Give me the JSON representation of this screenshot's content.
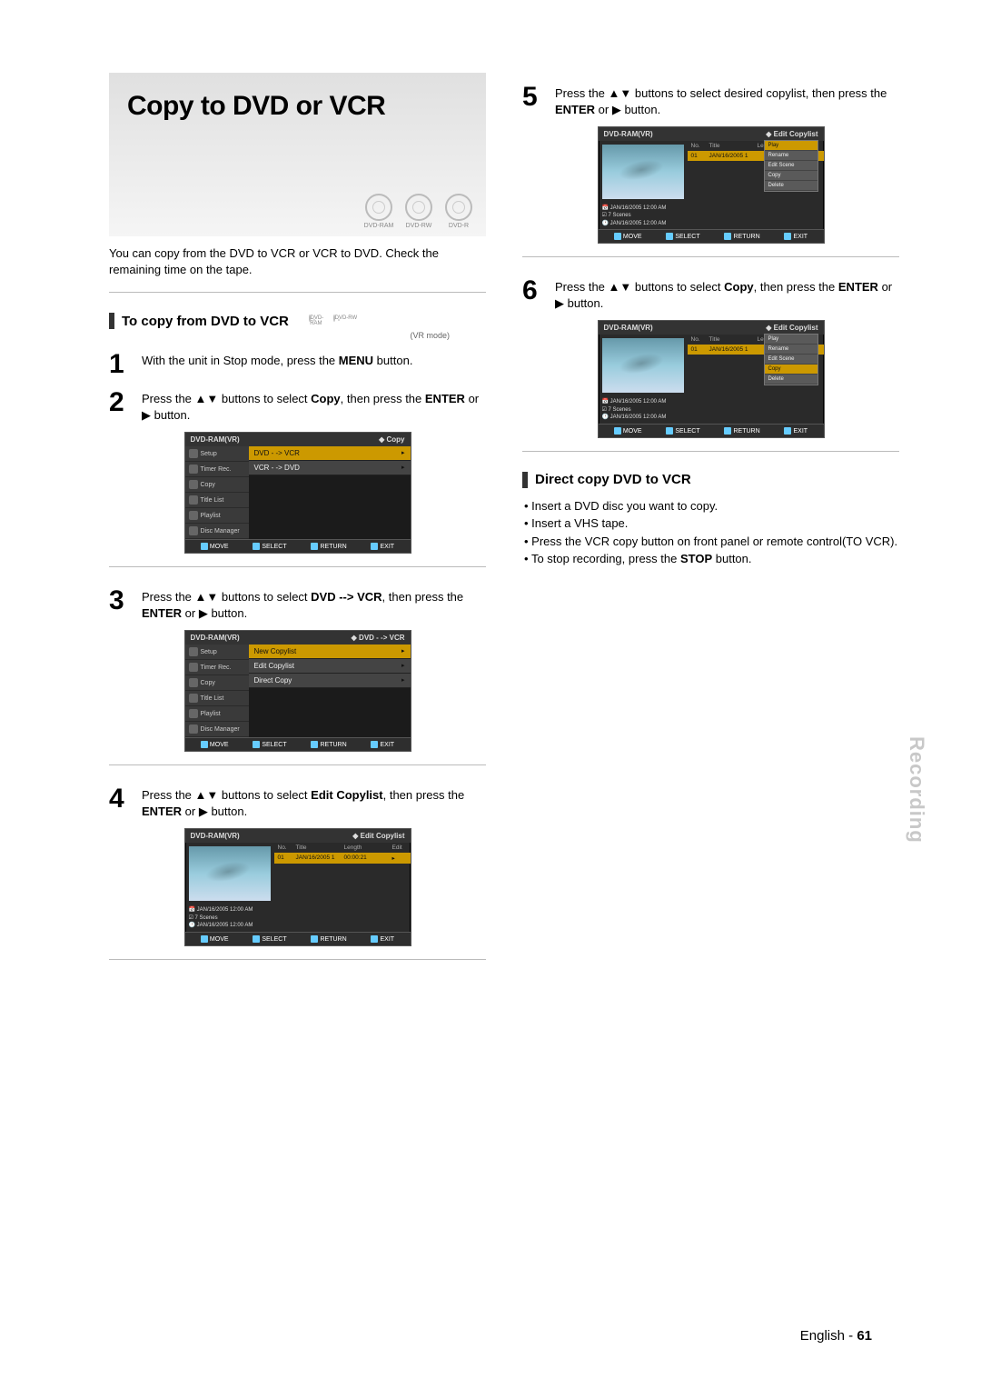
{
  "hero": {
    "title": "Copy to DVD or VCR",
    "badges": [
      "DVD-RAM",
      "DVD-RW",
      "DVD-R"
    ]
  },
  "intro": "You can copy from the DVD to VCR or VCR to DVD. Check the remaining time on the tape.",
  "section_a": {
    "title": "To copy from DVD to VCR",
    "badges": [
      "DVD-RAM",
      "DVD-RW"
    ],
    "vr_mode": "(VR mode)",
    "steps": {
      "s1": {
        "num": "1",
        "text_a": "With the unit in Stop mode, press the ",
        "bold": "MENU",
        "text_b": " button."
      },
      "s2": {
        "num": "2",
        "text_a": "Press the ▲▼ buttons to select ",
        "bold": "Copy",
        "text_b": ", then press the ",
        "bold2": "ENTER",
        "text_c": " or ▶ button."
      },
      "s3": {
        "num": "3",
        "text_a": "Press the ▲▼ buttons to select ",
        "bold": "DVD --> VCR",
        "text_b": ", then press the ",
        "bold2": "ENTER",
        "text_c": " or ▶ button."
      },
      "s4": {
        "num": "4",
        "text_a": "Press the ▲▼ buttons to select ",
        "bold": "Edit Copylist",
        "text_b": ", then press the ",
        "bold2": "ENTER",
        "text_c": " or ▶ button."
      },
      "s5": {
        "num": "5",
        "text_a": "Press the ▲▼ buttons to select desired copylist, then press the ",
        "bold": "ENTER",
        "text_b": " or ▶ button."
      },
      "s6": {
        "num": "6",
        "text_a": "Press the ▲▼ buttons to select ",
        "bold": "Copy",
        "text_b": ", then press the ",
        "bold2": "ENTER",
        "text_c": " or ▶ button."
      }
    }
  },
  "osd": {
    "device": "DVD-RAM(VR)",
    "side_items": [
      "Setup",
      "Timer Rec.",
      "Copy",
      "Title List",
      "Playlist",
      "Disc Manager"
    ],
    "footer": {
      "move": "MOVE",
      "select": "SELECT",
      "return": "RETURN",
      "exit": "EXIT"
    },
    "screen2": {
      "crumb": "Copy",
      "items": [
        "DVD - -> VCR",
        "VCR - -> DVD"
      ]
    },
    "screen3": {
      "crumb": "DVD - -> VCR",
      "items": [
        "New Copylist",
        "Edit Copylist",
        "Direct Copy"
      ]
    },
    "screen4": {
      "crumb": "Edit Copylist",
      "thead": {
        "no": "No.",
        "title": "Title",
        "length": "Length",
        "edit": "Edit"
      },
      "row": {
        "no": "01",
        "title": "JAN/16/2005 1",
        "length": "00:00:21",
        "edit": "▸"
      },
      "info": [
        "JAN/16/2005 12:00 AM",
        "7 Scenes",
        "JAN/16/2005 12:00 AM"
      ]
    },
    "screen5": {
      "crumb": "Edit Copylist",
      "menu": [
        "Play",
        "Rename",
        "Edit Scene",
        "Copy",
        "Delete"
      ],
      "highlight_s5": "Play",
      "highlight_s6": "Copy"
    }
  },
  "section_b": {
    "title": "Direct copy DVD to VCR",
    "bullets_lines": {
      "b1": "Insert a DVD disc you want to copy.",
      "b2": "Insert a VHS tape.",
      "b3": "Press the VCR copy button on front panel or remote control(TO VCR).",
      "b4_a": "To stop recording, press the ",
      "b4_bold": "STOP",
      "b4_b": " button."
    }
  },
  "side_tab": "Recording",
  "footer": {
    "lang": "English",
    "sep": " - ",
    "page": "61"
  }
}
